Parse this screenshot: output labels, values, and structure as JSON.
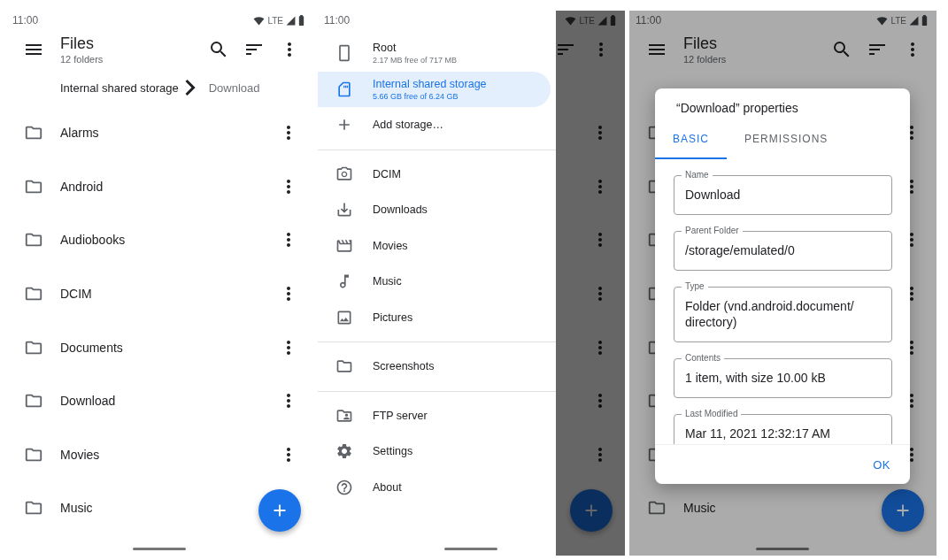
{
  "files_screen": {
    "status_bar": {
      "time": "11:00",
      "network": "LTE"
    },
    "toolbar": {
      "title": "Files",
      "subtitle": "12 folders"
    },
    "breadcrumb": [
      {
        "label": "Internal shared storage",
        "current": false
      },
      {
        "label": "Download",
        "current": true
      }
    ],
    "folders": [
      "Alarms",
      "Android",
      "Audiobooks",
      "DCIM",
      "Documents",
      "Download",
      "Movies",
      "Music"
    ]
  },
  "drawer_screen": {
    "status_bar": {
      "time": "11:00",
      "network": "LTE"
    },
    "sections": [
      {
        "items": [
          {
            "label": "Root",
            "detail": "2.17 MB free of 717 MB",
            "selected": false
          },
          {
            "label": "Internal shared storage",
            "detail": "5.66 GB free of 6.24 GB",
            "selected": true
          },
          {
            "label": "Add storage…",
            "selected": false
          }
        ]
      },
      {
        "items": [
          {
            "label": "DCIM",
            "selected": false
          },
          {
            "label": "Downloads",
            "selected": false
          },
          {
            "label": "Movies",
            "selected": false
          },
          {
            "label": "Music",
            "selected": false
          },
          {
            "label": "Pictures",
            "selected": false
          }
        ]
      },
      {
        "items": [
          {
            "label": "Screenshots",
            "selected": false
          }
        ]
      },
      {
        "items": [
          {
            "label": "FTP server",
            "selected": false
          },
          {
            "label": "Settings",
            "selected": false
          },
          {
            "label": "About",
            "selected": false
          }
        ]
      }
    ]
  },
  "properties_screen": {
    "status_bar": {
      "time": "11:00",
      "network": "LTE"
    },
    "toolbar": {
      "title": "Files",
      "subtitle": "12 folders"
    },
    "folders": [
      "Music"
    ],
    "dialog": {
      "title": "“Download” properties",
      "tabs": [
        {
          "label": "BASIC",
          "selected": true
        },
        {
          "label": "PERMISSIONS",
          "selected": false
        }
      ],
      "fields": [
        {
          "label": "Name",
          "value": "Download"
        },
        {
          "label": "Parent Folder",
          "value": "/storage/emulated/0"
        },
        {
          "label": "Type",
          "value": "Folder (vnd.android.document/ directory)"
        },
        {
          "label": "Contents",
          "value": "1 item, with size 10.00 kB"
        },
        {
          "label": "Last Modified",
          "value": "Mar 11, 2021 12:32:17 AM"
        }
      ],
      "buttons": [
        "OK"
      ]
    }
  }
}
